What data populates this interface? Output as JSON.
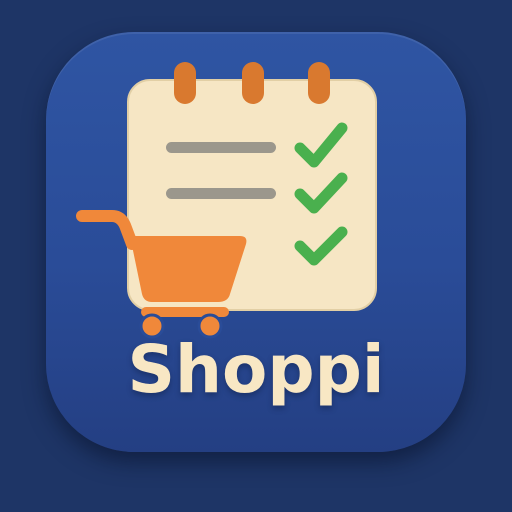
{
  "app": {
    "name": "Shoppi"
  },
  "icons": {
    "main": "notepad-checklist-icon",
    "cart": "shopping-cart-icon",
    "check": "check-mark-icon"
  },
  "colors": {
    "page_background": "#1e3566",
    "icon_background": "#2a4c98",
    "notepad_paper": "#f6e6c4",
    "notepad_ring": "#d9792f",
    "list_line": "#9b978c",
    "check": "#4ab04e",
    "cart": "#f0883a",
    "app_name_text": "#f8e7c4"
  }
}
